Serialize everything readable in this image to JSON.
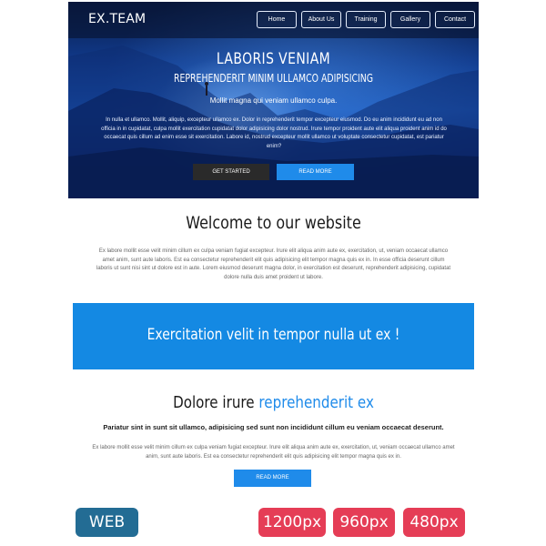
{
  "header": {
    "logo": "EX.TEAM",
    "nav": [
      "Home",
      "About Us",
      "Training",
      "Gallery",
      "Contact"
    ]
  },
  "hero": {
    "title": "LABORIS VENIAM",
    "subtitle": "REPREHENDERIT MINIM ULLAMCO ADIPISICING",
    "tagline": "Mollit magna qui veniam ullamco culpa.",
    "paragraph": "In nulla et ullamco. Mollit, aliquip, excepteur ullamco ex. Dolor in reprehenderit tempor excepteur eiusmod. Do eu anim incididunt eu ad non officia in in cupidatat, culpa mollit exercitation cupidatat dolor adipisicing dolor nostrud. Irure tempor proident aute elit aliqua proident anim id do occaecat quis cillum ad enim esse sit exercitation. Labore id, nostrud excepteur mollit ullamco ut voluptate consectetur cupidatat, est pariatur enim?",
    "btn_started": "GET STARTED",
    "btn_more": "READ MORE"
  },
  "welcome": {
    "title": "Welcome to our website",
    "paragraph": "Ex labore mollit esse velit minim cillum ex culpa veniam fugiat excepteur. Irure elit aliqua anim aute ex, exercitation, ut, veniam occaecat ullamco amet anim, sunt aute laboris. Est ea consectetur reprehenderit elit quis adipisicing elit tempor magna quis ex in. In esse officia deserunt cillum laboris ut sunt nisi sint ut dolore est in aute. Lorem eiusmod deserunt magna dolor, in exercitation est deserunt, reprehenderit adipisicing, cupidatat dolore nulla duis amet proident ut labore."
  },
  "banner": {
    "text": "Exercitation velit in tempor nulla ut ex !"
  },
  "section": {
    "title_plain": "Dolore irure",
    "title_accent": "reprehenderit ex",
    "bold_line": "Pariatur sint in sunt sit ullamco, adipisicing sed sunt non incididunt cillum eu veniam occaecat deserunt.",
    "paragraph": "Ex labore mollit esse velit minim cillum ex culpa veniam fugiat excepteur. Irure elit aliqua anim aute ex, exercitation, ut, veniam occaecat ullamco amet anim, sunt aute laboris. Est ea consectetur reprehenderit elit quis adipisicing elit tempor magna quis ex in.",
    "btn_more": "READ MORE"
  },
  "badges": {
    "web": "WEB",
    "b1200": "1200px",
    "b960": "960px",
    "b480": "480px"
  },
  "colors": {
    "accent": "#1f8bea",
    "banner": "#1489e3",
    "badge_web": "#236c94",
    "badge_size": "#e53d56"
  }
}
